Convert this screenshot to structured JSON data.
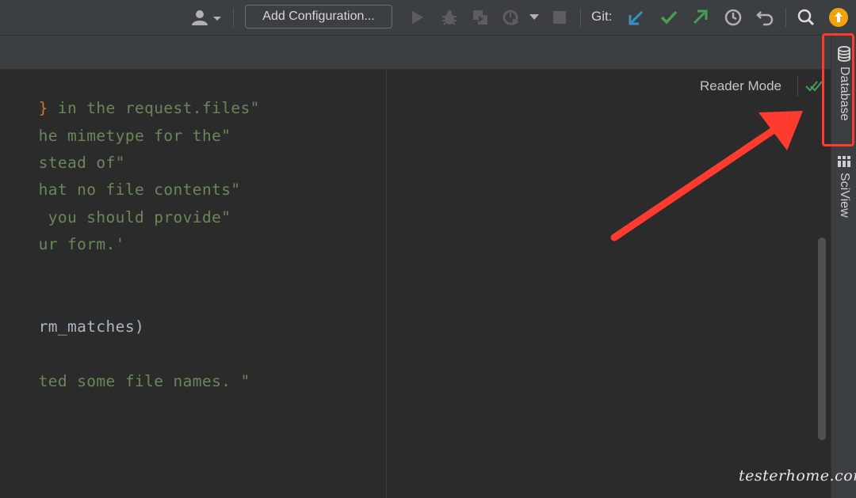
{
  "toolbar": {
    "user_icon": "user-icon",
    "config_label": "Add Configuration...",
    "git_label": "Git:",
    "icons": [
      "run-icon",
      "debug-icon",
      "coverage-icon",
      "profile-icon",
      "chevron-down-icon",
      "stop-icon",
      "git-update-icon",
      "git-commit-icon",
      "git-push-icon",
      "history-icon",
      "rollback-icon",
      "search-icon",
      "update-icon"
    ]
  },
  "editor": {
    "lines": [
      {
        "brace": "}",
        "str": " in the request.files\""
      },
      {
        "str": "he mimetype for the\""
      },
      {
        "str": "stead of\""
      },
      {
        "str": "hat no file contents\""
      },
      {
        "str": " you should provide\""
      },
      {
        "str": "ur form.'"
      },
      {
        "plain": "rm_matches)"
      },
      {
        "str": "ted some file names. \""
      }
    ]
  },
  "preview": {
    "reader_mode": "Reader Mode"
  },
  "sidebar": {
    "tabs": [
      {
        "label": "Database",
        "icon": "database-icon"
      },
      {
        "label": "SciView",
        "icon": "sciview-icon"
      }
    ]
  },
  "annotation": {
    "color": "#ff3b30"
  },
  "watermark": "testerhome.com",
  "colors": {
    "string": "#6a8759",
    "brace": "#cc7832",
    "git_update": "#3592c4",
    "git_commit": "#499c54",
    "git_push": "#499c54",
    "update_badge": "#f0a30a"
  }
}
